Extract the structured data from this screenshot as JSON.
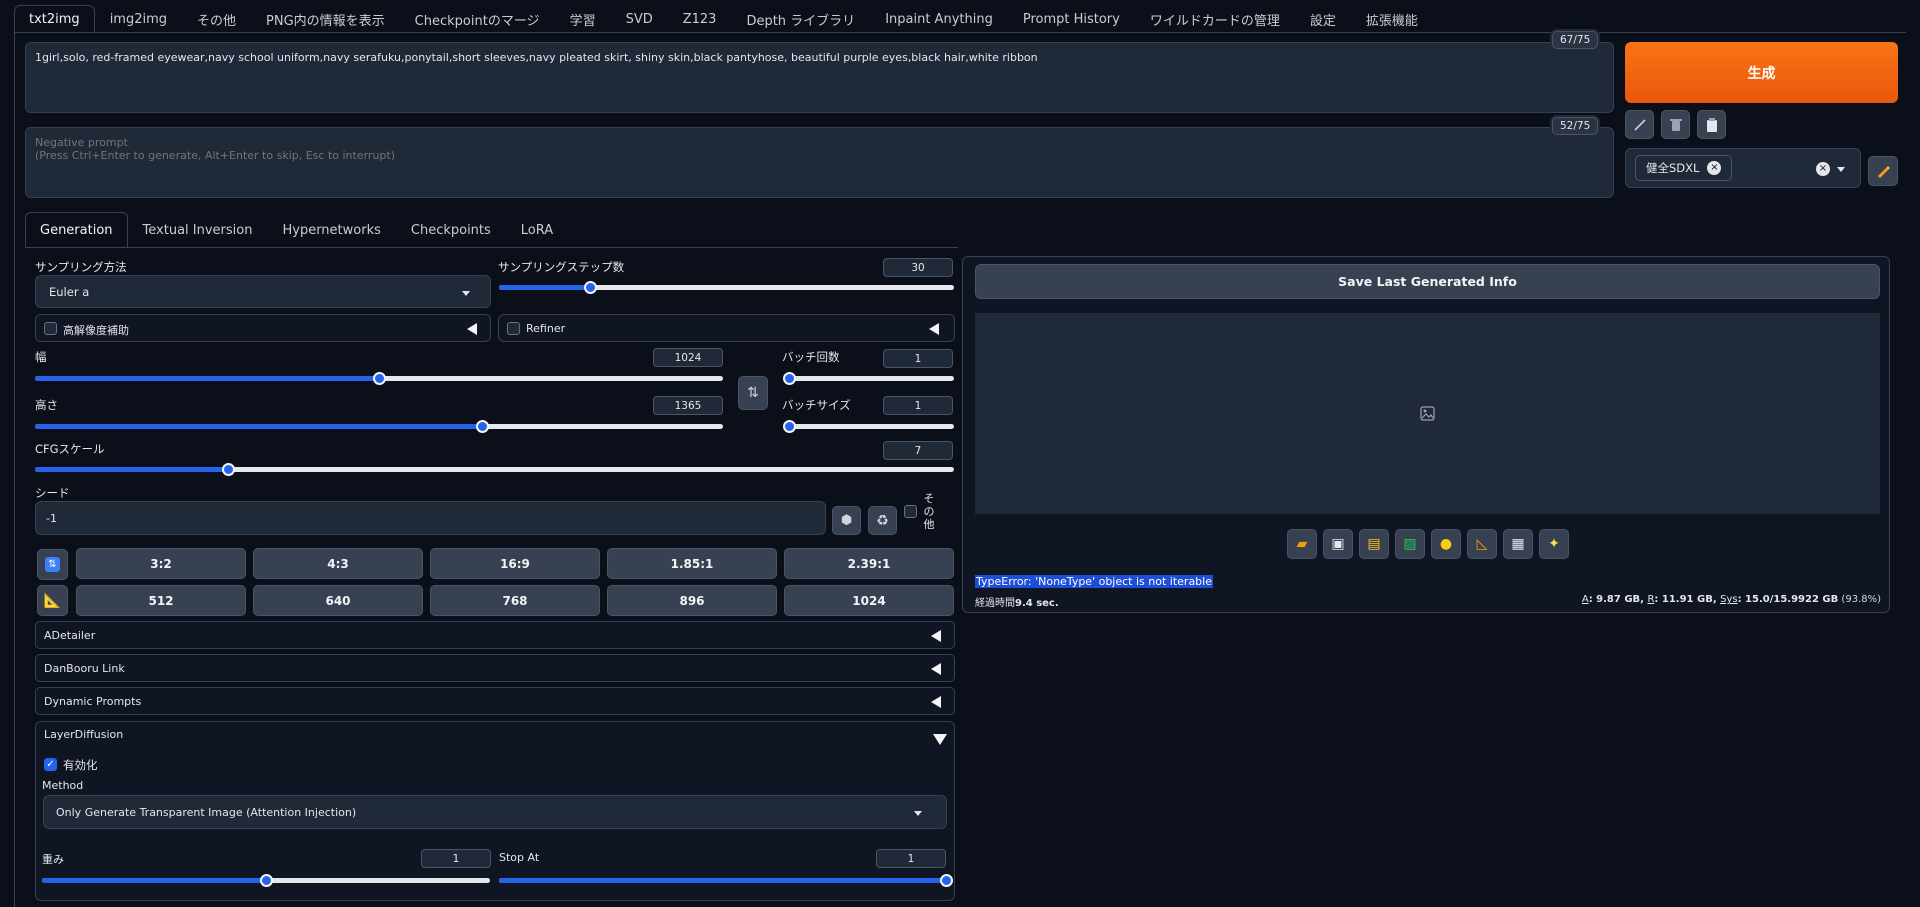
{
  "top_tabs": [
    "txt2img",
    "img2img",
    "その他",
    "PNG内の情報を表示",
    "Checkpointのマージ",
    "学習",
    "SVD",
    "Z123",
    "Depth ライブラリ",
    "Inpaint Anything",
    "Prompt History",
    "ワイルドカードの管理",
    "設定",
    "拡張機能"
  ],
  "prompt": {
    "value": "1girl,solo, red-framed eyewear,navy school uniform,navy serafuku,ponytail,short sleeves,navy pleated skirt, shiny skin,black pantyhose, beautiful purple eyes,black hair,white ribbon",
    "counter": "67/75"
  },
  "negative_prompt": {
    "placeholder": "Negative prompt\n(Press Ctrl+Enter to generate, Alt+Enter to skip, Esc to interrupt)",
    "counter": "52/75"
  },
  "generate_label": "生成",
  "styles": {
    "chip": "健全SDXL",
    "chip_close": "×",
    "clear": "×"
  },
  "sub_tabs": [
    "Generation",
    "Textual Inversion",
    "Hypernetworks",
    "Checkpoints",
    "LoRA"
  ],
  "sampling": {
    "method_label": "サンプリング方法",
    "method_value": "Euler a",
    "steps_label": "サンプリングステップ数",
    "steps_value": "30",
    "steps_fraction": 0.2
  },
  "hires_label": "高解像度補助",
  "refiner_label": "Refiner",
  "width": {
    "label": "幅",
    "value": "1024",
    "fraction": 0.5
  },
  "height": {
    "label": "高さ",
    "value": "1365",
    "fraction": 0.65
  },
  "batch_count": {
    "label": "バッチ回数",
    "value": "1",
    "fraction": 0.0
  },
  "batch_size": {
    "label": "バッチサイズ",
    "value": "1",
    "fraction": 0.0
  },
  "cfg": {
    "label": "CFGスケール",
    "value": "7",
    "fraction": 0.21
  },
  "seed": {
    "label": "シード",
    "value": "-1",
    "extra_label": "その他"
  },
  "ratio_buttons": [
    "3:2",
    "4:3",
    "16:9",
    "1.85:1",
    "2.39:1"
  ],
  "size_buttons": [
    "512",
    "640",
    "768",
    "896",
    "1024"
  ],
  "accordions": [
    "ADetailer",
    "DanBooru Link",
    "Dynamic Prompts"
  ],
  "layer_diffusion": {
    "title": "LayerDiffusion",
    "enable_label": "有効化",
    "method_label": "Method",
    "method_value": "Only Generate Transparent Image (Attention Injection)",
    "weight_label": "重み",
    "weight_value": "1",
    "weight_fraction": 0.5,
    "stop_at_label": "Stop At",
    "stop_at_value": "1",
    "stop_at_fraction": 1.0
  },
  "output": {
    "save_info_label": "Save Last Generated Info",
    "error_text": "TypeError: 'NoneType' object is not iterable",
    "elapsed_prefix": "経過時間",
    "elapsed_value": "9.4 sec.",
    "memory": {
      "a_label": "A",
      "a_value": ": 9.87 GB, ",
      "r_label": "R",
      "r_value": ": 11.91 GB, ",
      "sys_label": "Sys",
      "sys_value": ": 15.0/15.9922 GB",
      "percent": " (93.8%)"
    }
  }
}
